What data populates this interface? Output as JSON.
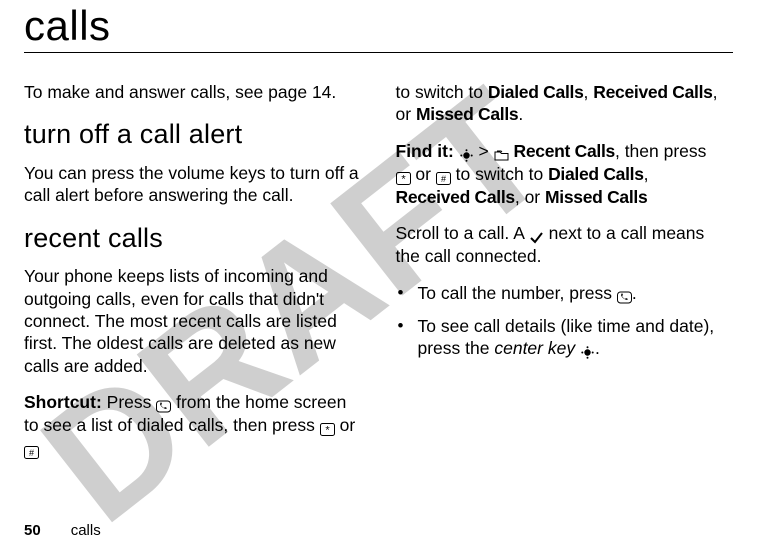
{
  "watermark": "DRAFT",
  "title": "calls",
  "left": {
    "intro": "To make and answer calls, see page 14.",
    "h_turnoff": "turn off a call alert",
    "turnoff_body": "You can press the volume keys to turn off a call alert before answering the call.",
    "h_recent": "recent calls",
    "recent_body": "Your phone keeps lists of incoming and outgoing calls, even for calls that didn't connect. The most recent calls are listed first. The oldest calls are deleted as new calls are added.",
    "shortcut_label": "Shortcut:",
    "shortcut_a": " Press ",
    "shortcut_b": " from the home screen to see a list of dialed calls, then press ",
    "shortcut_or": " or "
  },
  "right": {
    "cont_a": "to switch to ",
    "dialed": "Dialed Calls",
    "received": "Received Calls",
    "comma_or": ", or ",
    "missed": "Missed Calls",
    "period": ".",
    "findit_label": "Find it:",
    "findit_gt": " > ",
    "recent_calls": "Recent Calls",
    "findit_then": ", then press ",
    "findit_or": " or ",
    "findit_to": " to switch to ",
    "findit_comma": ", ",
    "findit_or2": ", or ",
    "scroll_a": "Scroll to a call. A ",
    "scroll_b": " next to a call means the call connected.",
    "bullet1_a": "To call the number, press ",
    "bullet1_b": ".",
    "bullet2_a": "To see call details (like time and date), press the ",
    "center_key": "center key",
    "bullet2_b": "."
  },
  "footer": {
    "page": "50",
    "section": "calls"
  },
  "icons": {
    "call": "call-key",
    "star": "star-key",
    "hash": "hash-key",
    "dot": "center-dot",
    "folder": "folder-icon",
    "check": "checkmark"
  }
}
